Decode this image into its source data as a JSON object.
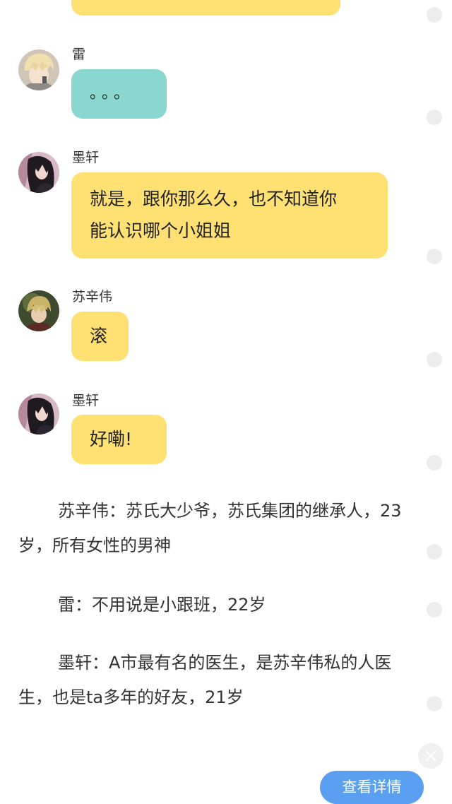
{
  "messages": [
    {
      "sender": "雷",
      "text": "。。。",
      "avatar_icon": "blond-anime-boy-avatar-icon",
      "bubble_color": "#89d7cf"
    },
    {
      "sender": "墨轩",
      "lines": [
        "就是，跟你那么久，也不知道你",
        "能认识哪个小姐姐"
      ],
      "avatar_icon": "dark-haired-anime-avatar-icon",
      "bubble_color": "#ffe072"
    },
    {
      "sender": "苏辛伟",
      "text": "滚",
      "avatar_icon": "anime-boy-avatar-icon",
      "bubble_color": "#ffe072"
    },
    {
      "sender": "墨轩",
      "text": "好嘞!",
      "avatar_icon": "dark-haired-anime-avatar-icon",
      "bubble_color": "#ffe072"
    }
  ],
  "story": {
    "paragraph1": "苏辛伟：苏氏大少爷，苏氏集团的继承人，23岁，所有女性的男神",
    "paragraph2": "雷：不用说是小跟班，22岁",
    "paragraph3": "墨轩：A市最有名的医生，是苏辛伟私的人医生，也是ta多年的好友，21岁"
  },
  "buttons": {
    "detail_label": "查看详情",
    "close_icon": "close-icon"
  },
  "colors": {
    "yellow_bubble": "#ffe072",
    "teal_bubble": "#89d7cf",
    "detail_button": "#5b9ff0"
  }
}
